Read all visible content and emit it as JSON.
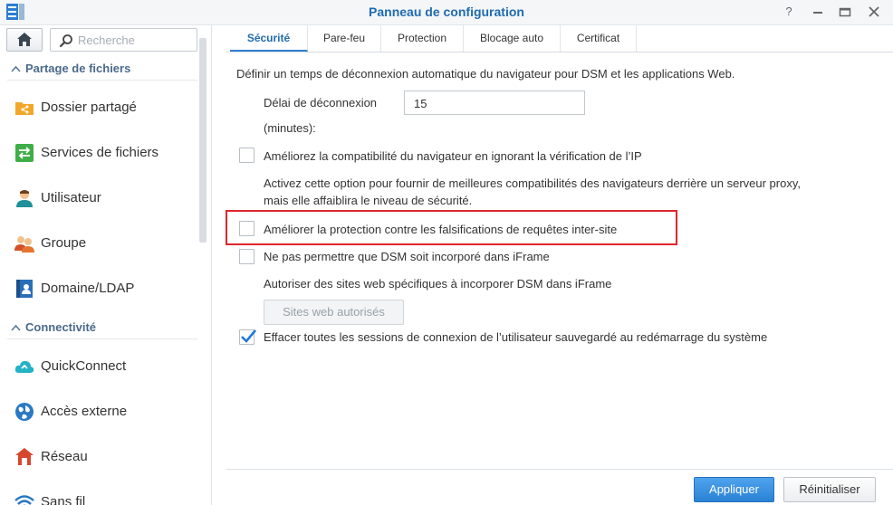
{
  "window": {
    "title": "Panneau de configuration",
    "controls": [
      "help-icon",
      "minimize-icon",
      "maximize-icon",
      "close-icon"
    ]
  },
  "sidebar": {
    "search_placeholder": "Recherche",
    "sections": [
      {
        "label": "Partage de fichiers",
        "items": [
          {
            "label": "Dossier partagé",
            "icon": "shared-folder-icon"
          },
          {
            "label": "Services de fichiers",
            "icon": "file-services-icon"
          },
          {
            "label": "Utilisateur",
            "icon": "user-icon"
          },
          {
            "label": "Groupe",
            "icon": "group-icon"
          },
          {
            "label": "Domaine/LDAP",
            "icon": "domain-ldap-icon"
          }
        ]
      },
      {
        "label": "Connectivité",
        "items": [
          {
            "label": "QuickConnect",
            "icon": "quickconnect-icon"
          },
          {
            "label": "Accès externe",
            "icon": "external-access-icon"
          },
          {
            "label": "Réseau",
            "icon": "network-icon"
          },
          {
            "label": "Sans fil",
            "icon": "wireless-icon"
          }
        ]
      }
    ]
  },
  "tabs": [
    {
      "label": "Sécurité",
      "active": true
    },
    {
      "label": "Pare-feu",
      "active": false
    },
    {
      "label": "Protection",
      "active": false
    },
    {
      "label": "Blocage auto",
      "active": false
    },
    {
      "label": "Certificat",
      "active": false
    }
  ],
  "settings": {
    "intro": "Définir un temps de déconnexion automatique du navigateur pour DSM et les applications Web.",
    "timeout_label": "Délai de déconnexion",
    "timeout_unit": "(minutes):",
    "timeout_value": "15",
    "options": [
      {
        "label": "Améliorez la compatibilité du navigateur en ignorant la vérification de l’IP",
        "checked": false
      },
      {
        "label": "Améliorer la protection contre les falsifications de requêtes inter-site",
        "checked": false
      },
      {
        "label": "Ne pas permettre que DSM soit incorporé dans iFrame",
        "checked": false
      },
      {
        "label": "Effacer toutes les sessions de connexion de l’utilisateur sauvegardé au redémarrage du système",
        "checked": true
      }
    ],
    "ip_note_line1": "Activez cette option pour fournir de meilleures compatibilités des navigateurs derrière un serveur proxy,",
    "ip_note_line2": "mais elle affaiblira le niveau de sécurité.",
    "iframe_note": "Autoriser des sites web spécifiques à incorporer DSM dans iFrame",
    "allowed_sites_button": "Sites web autorisés"
  },
  "footer": {
    "apply_label": "Appliquer",
    "reset_label": "Réinitialiser"
  },
  "colors": {
    "accent": "#1f6bb0",
    "primary_button": "#2b82d4",
    "highlight_box": "#e0262b"
  }
}
